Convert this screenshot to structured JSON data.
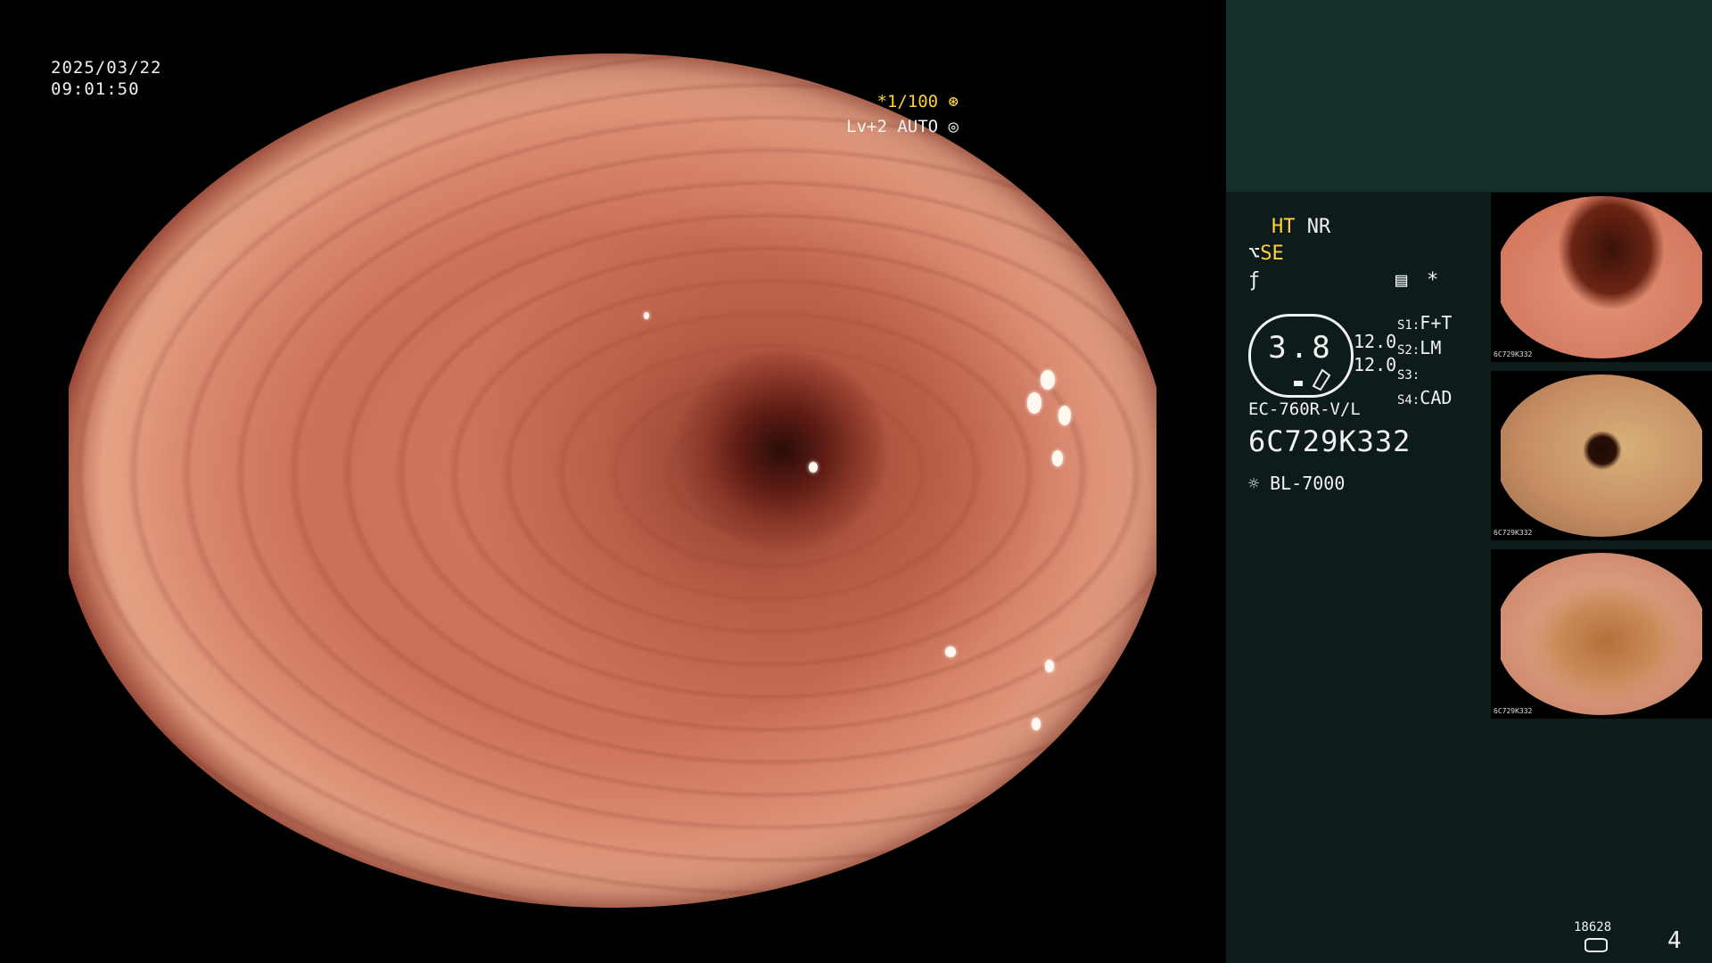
{
  "video": {
    "date": "2025/03/22",
    "time": "09:01:50",
    "shutter": "*1/100",
    "shutter_icon": "aperture-icon",
    "level": "Lv+2 AUTO",
    "level_icon": "iris-icon"
  },
  "panel": {
    "modes": {
      "ht": "HT",
      "nr": "NR",
      "se": "SE"
    },
    "gauge_value": "3.8",
    "gauge_lines": [
      "12.0",
      "12.0"
    ],
    "scope_settings": [
      {
        "key": "S1",
        "value": "F+T"
      },
      {
        "key": "S2",
        "value": "LM"
      },
      {
        "key": "S3",
        "value": ""
      },
      {
        "key": "S4",
        "value": "CAD"
      }
    ],
    "asterisk": "*",
    "model": "EC-760R-V/L",
    "serial": "6C729K332",
    "light_source": "BL-7000",
    "thumbnails": [
      {
        "label": "6C729K332"
      },
      {
        "label": "6C729K332"
      },
      {
        "label": "6C729K332"
      }
    ],
    "storage_count": "18628",
    "page": "4"
  },
  "colors": {
    "accent_yellow": "#ffd23a",
    "panel_bg": "#0d1b1a",
    "panel_top": "#14302c"
  }
}
